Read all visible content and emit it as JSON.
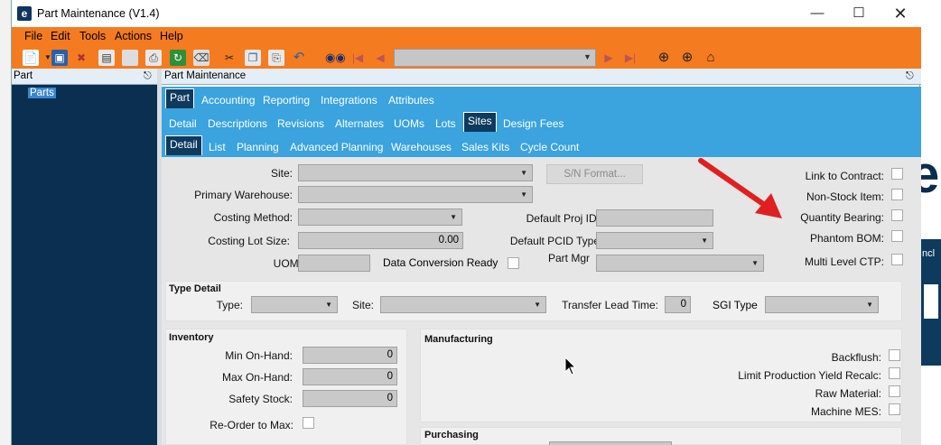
{
  "window": {
    "title": "Part Maintenance (V1.4)",
    "icon": "epicor-logo-icon",
    "controls": [
      "minimize",
      "maximize",
      "close"
    ]
  },
  "menu": [
    "File",
    "Edit",
    "Tools",
    "Actions",
    "Help"
  ],
  "toolbar": {
    "icons": [
      "new-icon",
      "save-icon",
      "delete-icon",
      "book-icon",
      "clear-icon",
      "print-icon",
      "refresh-icon",
      "eraser-icon",
      "cut-icon",
      "copy-icon",
      "paste-icon",
      "undo-icon",
      "binoculars-icon",
      "first-record-icon",
      "prev-record-icon",
      "next-record-icon",
      "last-record-icon",
      "back-icon",
      "forward-icon",
      "home-icon"
    ],
    "combo_value": ""
  },
  "left_pane": {
    "title": "Part",
    "tree_items": [
      "Parts"
    ]
  },
  "right_pane": {
    "title": "Part Maintenance"
  },
  "tabs_level1": [
    "Part",
    "Accounting",
    "Reporting",
    "Integrations",
    "Attributes"
  ],
  "tabs_level2": [
    "Detail",
    "Descriptions",
    "Revisions",
    "Alternates",
    "UOMs",
    "Lots",
    "Sites",
    "Design Fees"
  ],
  "tabs_level3": [
    "Detail",
    "List",
    "Planning",
    "Advanced Planning",
    "Warehouses",
    "Sales Kits",
    "Cycle Count"
  ],
  "selected": {
    "level1": "Part",
    "level2": "Sites",
    "level3": "Detail"
  },
  "form": {
    "site": "Site:",
    "primary_warehouse": "Primary Warehouse:",
    "costing_method": "Costing Method:",
    "costing_lot_size": "Costing Lot Size:",
    "costing_lot_size_value": "0.00",
    "uom": "UOM:",
    "data_conversion_ready": "Data Conversion Ready",
    "sn_format": "S/N Format...",
    "default_proj_id": "Default Proj ID:",
    "default_pcid_type": "Default PCID Type",
    "part_mgr": "Part Mgr",
    "link_to_contract": "Link to Contract:",
    "non_stock_item": "Non-Stock Item:",
    "quantity_bearing": "Quantity Bearing:",
    "phantom_bom": "Phantom BOM:",
    "multi_level_ctp": "Multi Level CTP:"
  },
  "type_detail": {
    "title": "Type Detail",
    "type": "Type:",
    "site": "Site:",
    "transfer_lead_time": "Transfer Lead Time:",
    "transfer_lead_time_value": "0",
    "sgi_type": "SGI Type"
  },
  "inventory": {
    "title": "Inventory",
    "min_on_hand": "Min On-Hand:",
    "min_value": "0",
    "max_on_hand": "Max On-Hand:",
    "max_value": "0",
    "safety_stock": "Safety Stock:",
    "safety_value": "0",
    "reorder_to_max": "Re-Order to Max:"
  },
  "manufacturing": {
    "title": "Manufacturing",
    "backflush": "Backflush:",
    "limit_yield": "Limit Production Yield Recalc:",
    "raw_material": "Raw Material:",
    "machine_mes": "Machine MES:"
  },
  "purchasing": {
    "title": "Purchasing"
  },
  "annotation": {
    "arrow_color": "#e02020",
    "points_to": "Quantity Bearing"
  },
  "background_app": {
    "partial_text": "ncl"
  },
  "colors": {
    "accent_orange": "#f57b20",
    "tab_blue": "#3ba3de",
    "navy": "#0b2f51"
  }
}
